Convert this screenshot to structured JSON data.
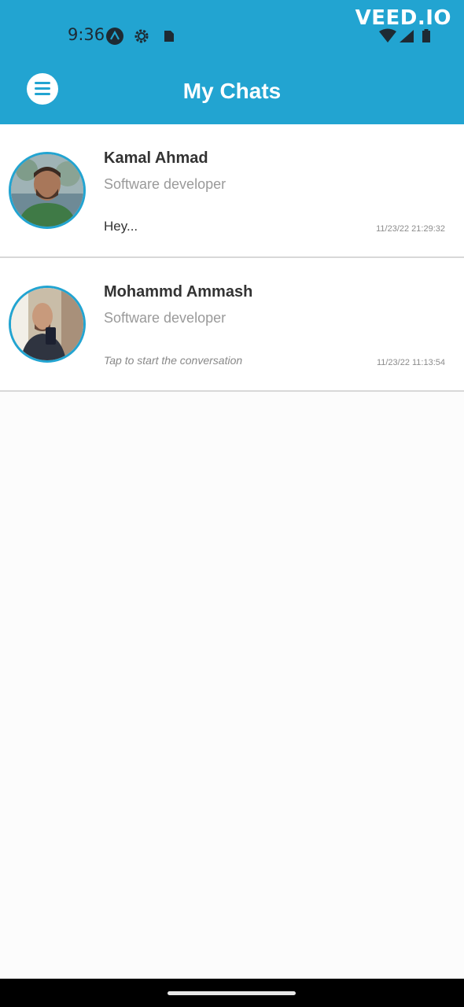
{
  "status_bar": {
    "time": "9:36",
    "watermark": "VEED.IO",
    "icons": [
      "app-icon",
      "settings-gear-icon",
      "sd-card-icon",
      "wifi-icon",
      "signal-icon",
      "battery-icon"
    ]
  },
  "header": {
    "title": "My Chats",
    "menu_icon": "hamburger-menu-icon",
    "background_color": "#22a4d1"
  },
  "chats": [
    {
      "name": "Kamal Ahmad",
      "subtitle": "Software developer",
      "last_message": "Hey...",
      "timestamp": "11/23/22 21:29:32"
    },
    {
      "name": "Mohammd Ammash",
      "subtitle": "Software developer",
      "last_message": "Tap to start the conversation",
      "timestamp": "11/23/22 11:13:54"
    }
  ],
  "colors": {
    "accent": "#22a4d1",
    "divider": "#d8d8d8",
    "name_text": "#333333",
    "subtitle_text": "#9a9a9a"
  }
}
